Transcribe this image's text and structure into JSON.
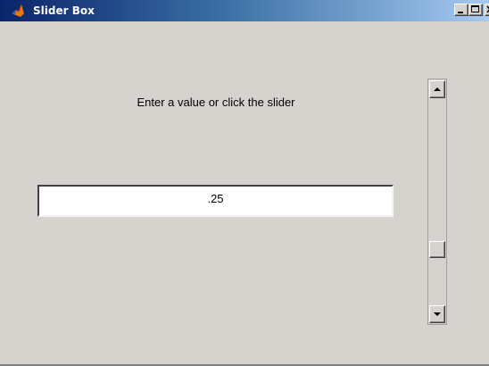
{
  "window": {
    "title": "Slider Box",
    "icon": "matlab-icon"
  },
  "caption_buttons": [
    "minimize-icon",
    "maximize-icon",
    "close-icon"
  ],
  "main": {
    "prompt": "Enter a value or click the slider",
    "value_input": ".25"
  },
  "slider": {
    "value": 0.25,
    "min": 0,
    "max": 1,
    "orientation": "vertical",
    "icons": [
      "arrow-up-icon",
      "arrow-down-icon"
    ]
  },
  "colors": {
    "face": "#d6d3ce",
    "title_start": "#0a246a",
    "title_end": "#a6caf0"
  }
}
